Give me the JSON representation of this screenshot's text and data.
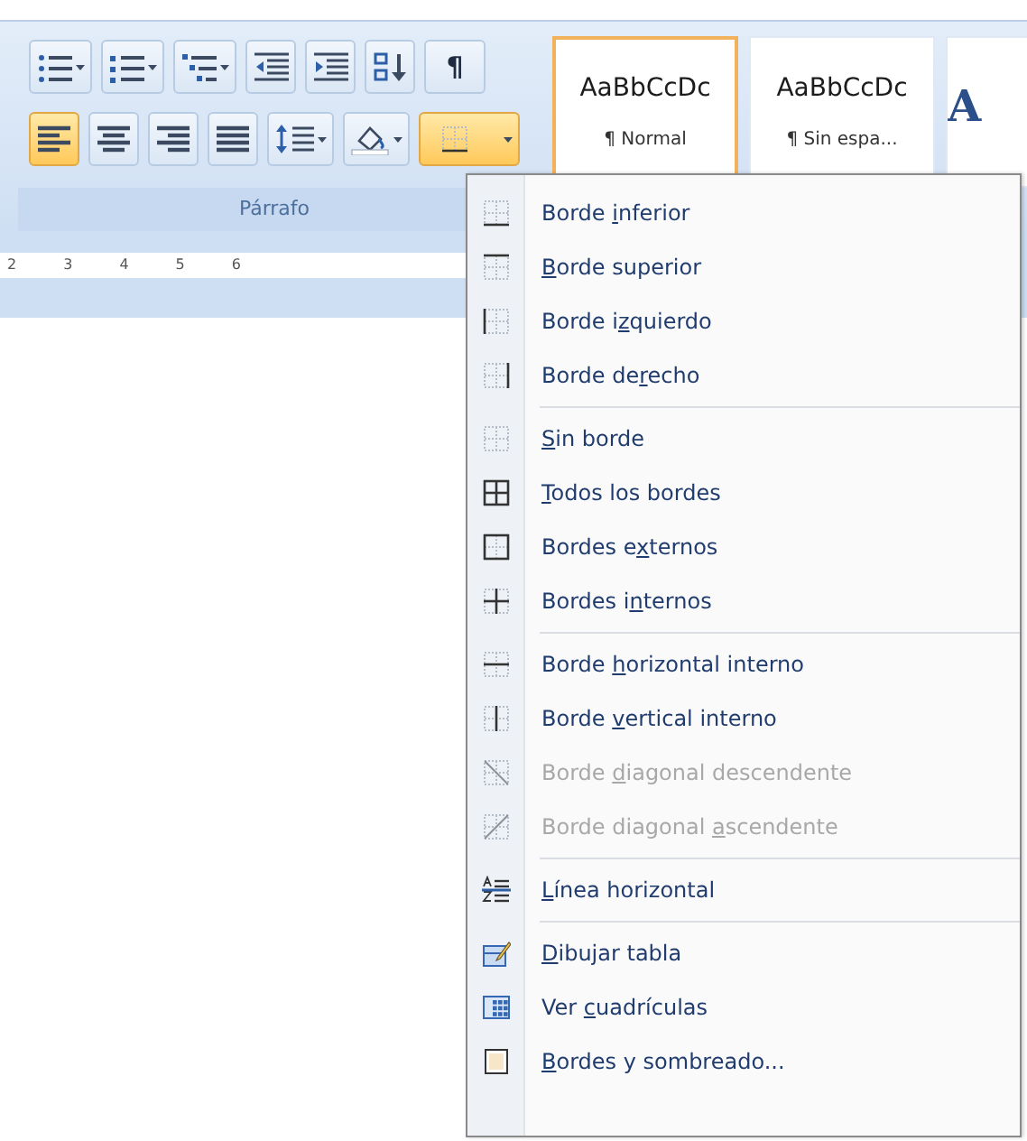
{
  "ribbon": {
    "paragraph_group": {
      "label": "Párrafo",
      "row_1": [
        {
          "kind": "bullets",
          "selected": false
        },
        {
          "kind": "numbering",
          "selected": false
        },
        {
          "kind": "multilevel",
          "selected": false
        },
        {
          "kind": "outdent",
          "selected": false
        },
        {
          "kind": "indent",
          "selected": false
        },
        {
          "kind": "sort",
          "selected": false
        },
        {
          "kind": "pilcrow",
          "label": "¶",
          "selected": false
        }
      ],
      "row_2": [
        {
          "kind": "align-left",
          "selected": true
        },
        {
          "kind": "align-center",
          "selected": false
        },
        {
          "kind": "align-right",
          "selected": false
        },
        {
          "kind": "justify",
          "selected": false
        },
        {
          "kind": "spacing",
          "selected": false
        },
        {
          "kind": "shading",
          "selected": false
        },
        {
          "kind": "borders",
          "selected": true
        }
      ]
    },
    "styles": [
      {
        "sample": "AaBbCcDc",
        "label": "¶ Normal",
        "selected": true
      },
      {
        "sample": "AaBbCcDc",
        "label": "¶ Sin espa...",
        "selected": false
      },
      {
        "sample": "A",
        "selected": false
      }
    ]
  },
  "ruler": [
    "2",
    "3",
    "4",
    "5",
    "6"
  ],
  "border_menu": [
    {
      "before": "Borde ",
      "key": "i",
      "after": "nferior",
      "disabled": false
    },
    {
      "key": "B",
      "after": "orde superior",
      "disabled": false
    },
    {
      "before": "Borde i",
      "key": "z",
      "after": "quierdo",
      "disabled": false
    },
    {
      "before": "Borde de",
      "key": "r",
      "after": "echo",
      "disabled": false,
      "separator_after": true
    },
    {
      "key": "S",
      "after": "in borde",
      "disabled": false
    },
    {
      "key": "T",
      "after": "odos los bordes",
      "disabled": false
    },
    {
      "before": "Bordes e",
      "key": "x",
      "after": "ternos",
      "disabled": false
    },
    {
      "before": "Bordes i",
      "key": "n",
      "after": "ternos",
      "disabled": false,
      "separator_after": true
    },
    {
      "before": "Borde ",
      "key": "h",
      "after": "orizontal interno",
      "disabled": false
    },
    {
      "before": "Borde ",
      "key": "v",
      "after": "ertical interno",
      "disabled": false
    },
    {
      "before": "Borde ",
      "key": "d",
      "after": "iagonal descendente",
      "disabled": true
    },
    {
      "before": "Borde diagonal ",
      "key": "a",
      "after": "scendente",
      "disabled": true,
      "separator_after": true
    },
    {
      "key": "L",
      "after": "ínea horizontal",
      "disabled": false,
      "separator_after": true
    },
    {
      "key": "D",
      "after": "ibujar tabla",
      "disabled": false
    },
    {
      "before": "Ver ",
      "key": "c",
      "after": "uadrículas",
      "disabled": false
    },
    {
      "key": "B",
      "after": "ordes y sombreado...",
      "disabled": false
    }
  ]
}
